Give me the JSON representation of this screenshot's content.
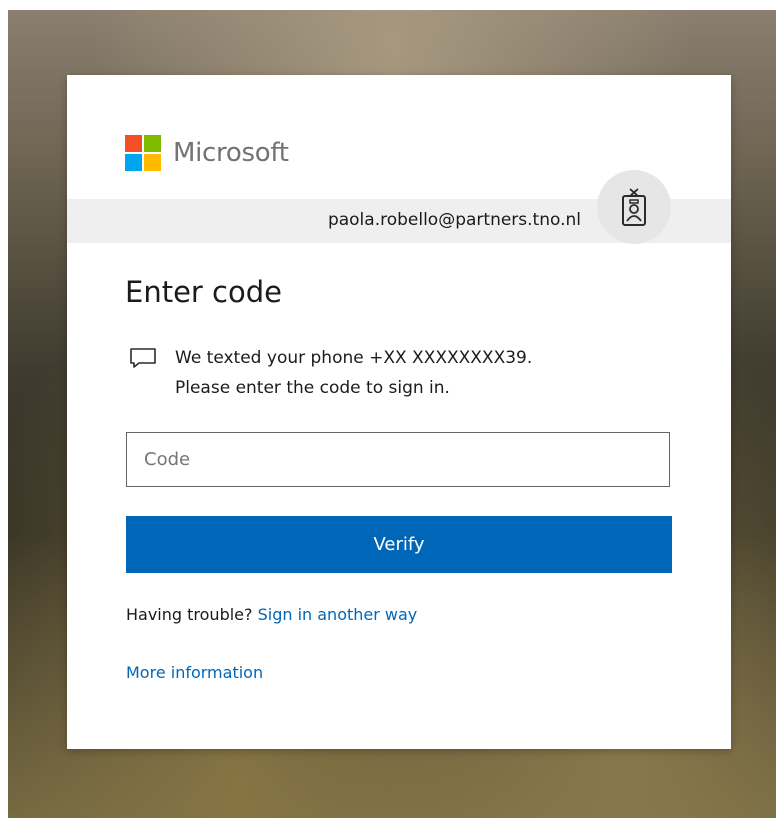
{
  "brand": {
    "name": "Microsoft",
    "logo_colors": [
      "#f25022",
      "#7fba00",
      "#00a4ef",
      "#ffb900"
    ]
  },
  "identity": {
    "email": "paola.robello@partners.tno.nl",
    "icon": "badge-icon"
  },
  "title": "Enter code",
  "message": {
    "icon": "chat-bubble-icon",
    "line1": "We texted your phone +XX XXXXXXXX39.",
    "line2": "Please enter the code to sign in."
  },
  "code_input": {
    "placeholder": "Code",
    "value": ""
  },
  "verify_label": "Verify",
  "trouble": {
    "prefix": "Having trouble?",
    "link": "Sign in another way"
  },
  "more_info_link": "More information",
  "colors": {
    "accent": "#0067b8",
    "text": "#1b1b1b",
    "input_border": "#666666"
  }
}
